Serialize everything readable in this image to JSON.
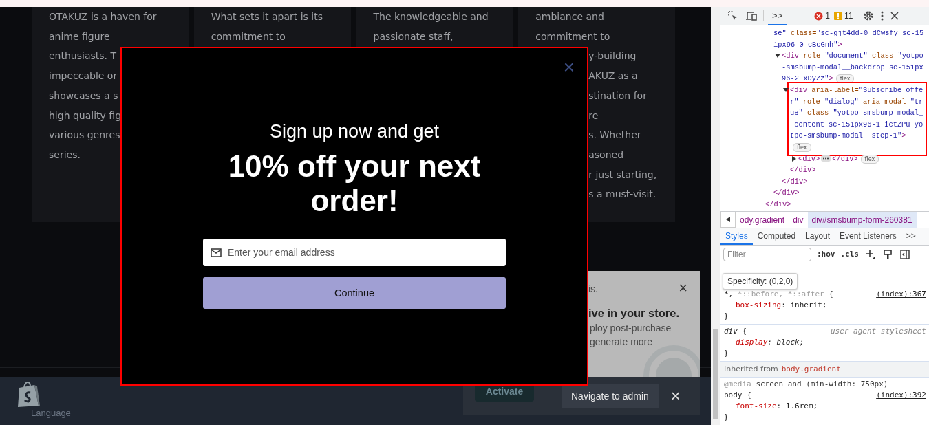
{
  "page": {
    "cards": [
      {
        "lines": [
          {
            "text": "OTAKUZ is a haven for",
            "cut_left": false
          },
          {
            "text": "anime figure",
            "cut_left": false
          },
          {
            "text": "enthusiasts. T",
            "cut_left": false
          },
          {
            "text": "impeccable or",
            "cut_left": false
          },
          {
            "text": "showcases a s",
            "cut_left": false
          },
          {
            "text": "high quality fig",
            "cut_left": false
          },
          {
            "text": "various genres",
            "cut_left": false
          },
          {
            "text": "series.",
            "cut_left": false
          }
        ]
      },
      {
        "lines": [
          {
            "text": "What sets it apart is its",
            "cut_left": false
          },
          {
            "text": "commitment to",
            "cut_left": false
          }
        ]
      },
      {
        "lines": [
          {
            "text": "The knowledgeable and",
            "cut_left": false
          },
          {
            "text": "passionate staff,",
            "cut_left": false
          }
        ]
      },
      {
        "lines": [
          {
            "text": "ambiance and",
            "cut_left": false
          },
          {
            "text": "commitment to",
            "cut_left": false
          },
          {
            "text": "y-building",
            "cut_left": true
          },
          {
            "text": "AKUZ as a",
            "cut_left": true
          },
          {
            "text": "stination for",
            "cut_left": true
          },
          {
            "text": "re",
            "cut_left": true
          },
          {
            "text": "s. Whether",
            "cut_left": true
          },
          {
            "text": "asoned",
            "cut_left": true
          },
          {
            "text": "r just starting,",
            "cut_left": true
          },
          {
            "text": "s a must-visit.",
            "cut_left": true
          }
        ]
      }
    ],
    "modal": {
      "highlighted": true,
      "close": "×",
      "title": "Sign up now and get",
      "heading": "10% off your next order!",
      "email_placeholder": "Enter your email address",
      "button": "Continue"
    },
    "popup": {
      "lines": [
        {
          "kind": "small",
          "text": "is."
        },
        {
          "kind": "bold",
          "text": "ive in your store."
        },
        {
          "kind": "body",
          "text": "ploy post-purchase"
        },
        {
          "kind": "body",
          "text": "generate more"
        }
      ],
      "close": "×"
    },
    "shopify_bar": {
      "language": "Language",
      "activate": "Activate",
      "navigate": "Navigate to admin",
      "close": "×"
    }
  },
  "devtools": {
    "toolbar": {
      "errors": "1",
      "warnings": "11",
      "more": ">>"
    },
    "dom_tree": {
      "close": "</div>",
      "children": [
        {
          "kind": "continuation",
          "open": "se\" class=\"sc-gjt4dd-0 dCwsfy sc-151px96-0 cBcGnh\">",
          "close": "</div>",
          "children": [
            {
              "kind": "element",
              "open": "<div role=\"document\" class=\"yotpo-smsbump-modal__backdrop sc-151px96-2 xDyZz\">",
              "badge": "flex",
              "expanded": true,
              "highlighted": false,
              "close": "</div>",
              "children": [
                {
                  "kind": "element",
                  "open": "<div aria-label=\"Subscribe offer\" role=\"dialog\" aria-modal=\"true\" class=\"yotpo-smsbump-modal__content sc-151px96-1 ictZPu yotpo-smsbump-modal__step-1\">",
                  "badge": "flex",
                  "expanded": true,
                  "highlighted": true,
                  "close": "</div>",
                  "children": [
                    {
                      "kind": "collapsed",
                      "open": "<div>",
                      "close": "</div>",
                      "badge": "flex",
                      "expanded": false,
                      "highlighted": false
                    }
                  ]
                }
              ]
            }
          ]
        }
      ]
    },
    "breadcrumbs": [
      {
        "text": "ody.gradient",
        "selected": false
      },
      {
        "text": "div",
        "selected": false
      },
      {
        "text": "div#smsbump-form-260381",
        "selected": true
      }
    ],
    "tabs": [
      {
        "label": "Styles",
        "selected": true
      },
      {
        "label": "Computed",
        "selected": false
      },
      {
        "label": "Layout",
        "selected": false
      },
      {
        "label": "Event Listeners",
        "selected": false
      }
    ],
    "tabs_more": ">>",
    "filter_placeholder": "Filter",
    "hov": ":hov",
    "cls": ".cls",
    "tooltip": "Specificity: (0,2,0)",
    "rules": [
      {
        "kind": "rule",
        "selector": [
          {
            "text": "*,",
            "matched": true
          },
          {
            "text": " *::before, *::after",
            "matched": false
          }
        ],
        "brace": "{",
        "source": "(index):367",
        "source_is_link": true,
        "decls": [
          {
            "prop": "box-sizing",
            "value": ": inherit;"
          }
        ],
        "end": "}"
      },
      {
        "kind": "rule",
        "selector": [
          {
            "text": "div",
            "matched": true
          }
        ],
        "brace": "{",
        "source": "user agent stylesheet",
        "source_is_link": false,
        "decls": [
          {
            "prop": "display",
            "value": ": block;"
          }
        ],
        "end": "}"
      },
      {
        "kind": "inherited",
        "label": "Inherited from",
        "target": "body.gradient"
      },
      {
        "kind": "media",
        "at": "@media",
        "query": "screen and (min-width: 750px)",
        "selector": [
          {
            "text": "body",
            "matched": true
          }
        ],
        "brace": "{",
        "source": "(index):392",
        "source_is_link": true,
        "decls": [
          {
            "prop": "font-size",
            "value": ": 1.6rem;"
          }
        ],
        "end": "}"
      }
    ]
  }
}
